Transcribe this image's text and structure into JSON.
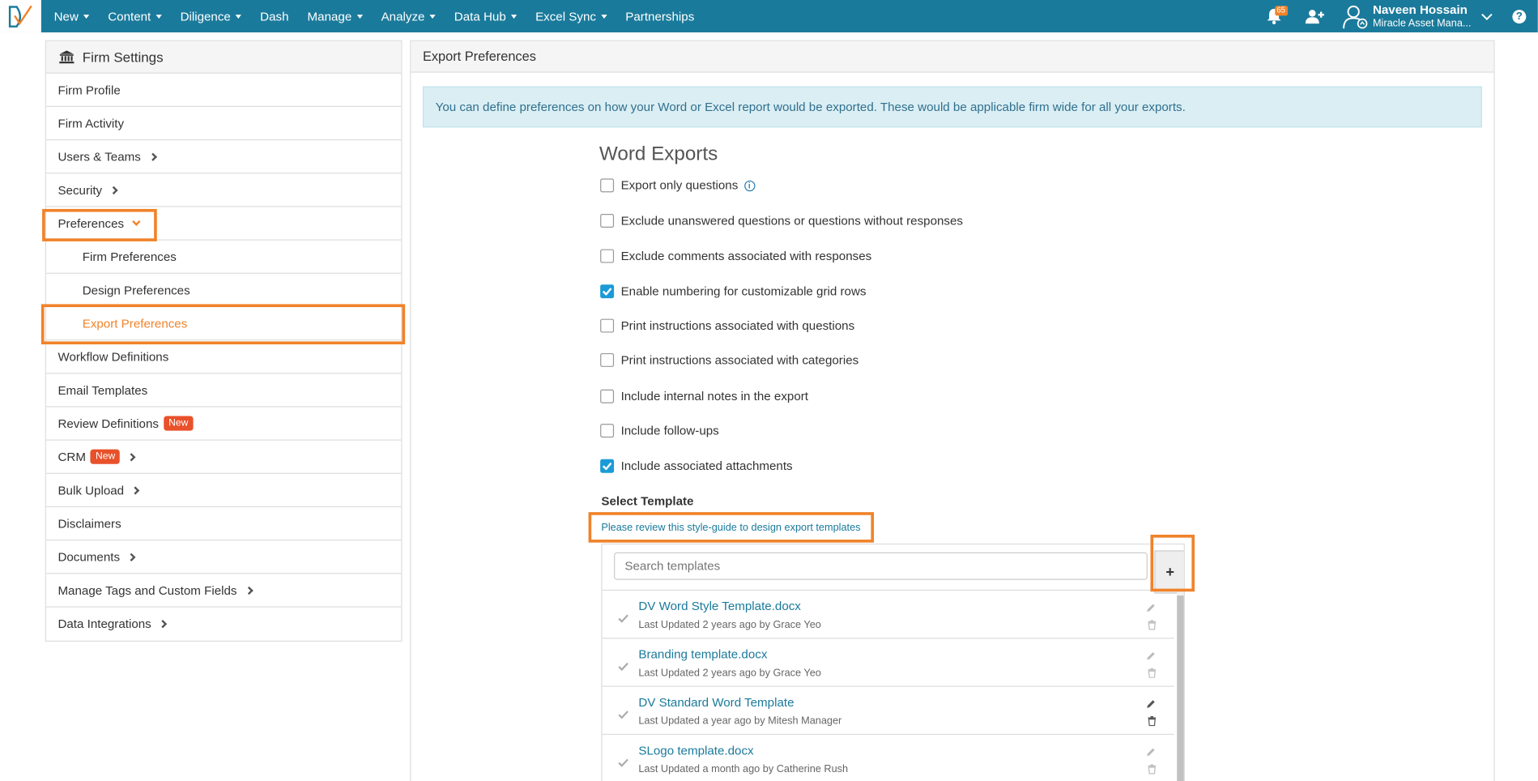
{
  "nav": {
    "items": [
      "New",
      "Content",
      "Diligence",
      "Dash",
      "Manage",
      "Analyze",
      "Data Hub",
      "Excel Sync",
      "Partnerships"
    ],
    "has_caret": [
      true,
      true,
      true,
      false,
      true,
      true,
      true,
      true,
      false
    ],
    "notification_count": "65",
    "user_name": "Naveen Hossain",
    "user_org": "Miracle Asset Mana...",
    "help_label": "?"
  },
  "sidebar": {
    "title": "Firm Settings",
    "items": [
      {
        "label": "Firm Profile"
      },
      {
        "label": "Firm Activity"
      },
      {
        "label": "Users & Teams",
        "chevron": true
      },
      {
        "label": "Security",
        "chevron": true
      },
      {
        "label": "Preferences",
        "expanded": true
      },
      {
        "label": "Firm Preferences",
        "sub": true
      },
      {
        "label": "Design Preferences",
        "sub": true
      },
      {
        "label": "Export Preferences",
        "sub": true,
        "active": true
      },
      {
        "label": "Workflow Definitions"
      },
      {
        "label": "Email Templates"
      },
      {
        "label": "Review Definitions",
        "badge": "New"
      },
      {
        "label": "CRM",
        "badge": "New",
        "chevron": true
      },
      {
        "label": "Bulk Upload",
        "chevron": true
      },
      {
        "label": "Disclaimers"
      },
      {
        "label": "Documents",
        "chevron": true
      },
      {
        "label": "Manage Tags and Custom Fields",
        "chevron": true
      },
      {
        "label": "Data Integrations",
        "chevron": true
      }
    ]
  },
  "main": {
    "title": "Export Preferences",
    "info": "You can define preferences on how your Word or Excel report would be exported. These would be applicable firm wide for all your exports.",
    "word_title": "Word Exports",
    "options": [
      {
        "label": "Export only questions",
        "checked": false,
        "info": true
      },
      {
        "label": "Exclude unanswered questions or questions without responses",
        "checked": false
      },
      {
        "label": "Exclude comments associated with responses",
        "checked": false
      },
      {
        "label": "Enable numbering for customizable grid rows",
        "checked": true
      },
      {
        "label": "Print instructions associated with questions",
        "checked": false
      },
      {
        "label": "Print instructions associated with categories",
        "checked": false
      },
      {
        "label": "Include internal notes in the export",
        "checked": false
      },
      {
        "label": "Include follow-ups",
        "checked": false
      },
      {
        "label": "Include associated attachments",
        "checked": true
      }
    ],
    "select_template": "Select Template",
    "guide_link": "Please review this style-guide to design export templates",
    "search_placeholder": "Search templates",
    "add_label": "+",
    "templates": [
      {
        "name": "DV Word Style Template.docx",
        "meta": "Last Updated 2 years ago by Grace Yeo",
        "editable": false
      },
      {
        "name": "Branding template.docx",
        "meta": "Last Updated 2 years ago by Grace Yeo",
        "editable": false
      },
      {
        "name": "DV Standard Word Template",
        "meta": "Last Updated a year ago by Mitesh Manager",
        "editable": true
      },
      {
        "name": "SLogo template.docx",
        "meta": "Last Updated a month ago by Catherine Rush",
        "editable": false
      }
    ]
  },
  "colors": {
    "nav_bg": "#1a7a9b",
    "accent": "#f0832a",
    "link": "#1a7a9b",
    "badge_new": "#e8512a"
  }
}
